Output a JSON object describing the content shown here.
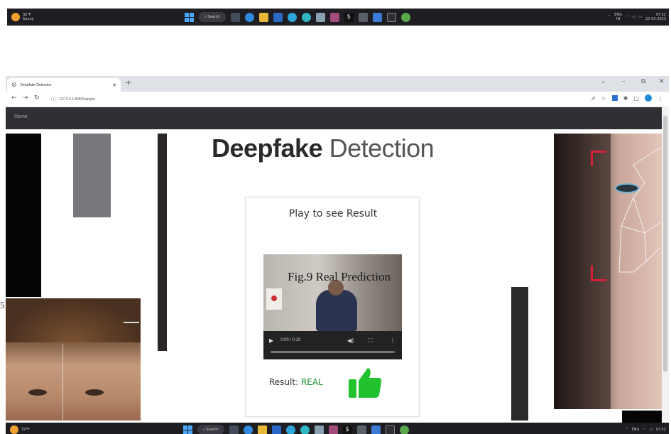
{
  "colors": {
    "taskbar_bg": "#1d1d22",
    "navbar_bg": "#2e2f33",
    "result_green": "#1a8f2c",
    "thumb_green": "#22c22e",
    "bracket_red": "#d8203c"
  },
  "taskbar": {
    "weather_temp": "32°F",
    "weather_desc": "Sunny",
    "search_label": "Search",
    "lang": "ENG",
    "lang_sub": "IN",
    "clock_time": "07:52",
    "clock_date": "22-03-2023",
    "apps": [
      "file-explorer-icon",
      "chrome-icon",
      "folder-icon",
      "mail-icon",
      "edge-icon",
      "store-icon",
      "photos-icon",
      "terminal-icon",
      "cmd-icon",
      "calculator-icon",
      "vscode-icon",
      "monitor-icon",
      "python-icon"
    ]
  },
  "browser": {
    "tab_title": "Deepfake Detection",
    "url": "127.0.0.1:8000/sample"
  },
  "page": {
    "nav_home": "Home",
    "title_strong": "Deepfake",
    "title_light": "Detection",
    "card_heading": "Play to see Result",
    "video_time": "0:00 / 0:10",
    "video_progress": 0.0,
    "result_label": "Result:",
    "result_value": "REAL"
  },
  "figure": {
    "caption": "Fig.9 Real Prediction",
    "stray_char": "5"
  }
}
